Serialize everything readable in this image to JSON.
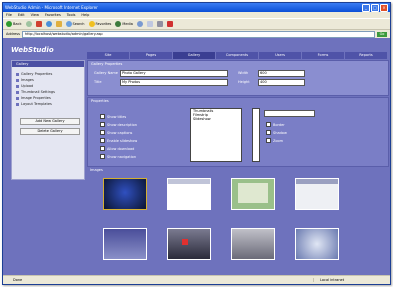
{
  "window": {
    "title": "WebStudio Admin - Microsoft Internet Explorer"
  },
  "menu": [
    "File",
    "Edit",
    "View",
    "Favorites",
    "Tools",
    "Help"
  ],
  "toolbar": {
    "back": "Back",
    "search": "Search",
    "favorites": "Favorites",
    "media": "Media"
  },
  "address": {
    "label": "Address",
    "value": "http://localhost/webstudio/admin/gallery.asp",
    "go": "Go"
  },
  "app": {
    "logo": "WebStudio"
  },
  "sidebar": {
    "header": "Gallery",
    "items": [
      "Gallery Properties",
      "Images",
      "Upload",
      "Thumbnail Settings",
      "Image Properties",
      "Layout Templates"
    ],
    "buttons": [
      "Add New Gallery",
      "Delete Gallery"
    ]
  },
  "tabs": [
    "Site",
    "Pages",
    "Gallery",
    "Components",
    "Users",
    "Forms",
    "Reports"
  ],
  "form": {
    "header": "Gallery Properties",
    "name_label": "Gallery Name",
    "name_value": "Photo Gallery",
    "width_label": "Width",
    "width_value": "600",
    "title_label": "Title",
    "title_value": "My Photos",
    "height_label": "Height",
    "height_value": "400"
  },
  "properties": {
    "header": "Properties",
    "checks": [
      "Show titles",
      "Show description",
      "Show captions",
      "Enable slideshow",
      "Allow download",
      "Show navigation"
    ],
    "options": [
      "Thumbnails",
      "Filmstrip",
      "Slideshow"
    ],
    "right_checks": [
      "Border",
      "Shadow",
      "Zoom"
    ]
  },
  "gallery": {
    "header": "Images"
  },
  "status": {
    "text": "Done",
    "zone": "Local intranet"
  },
  "colors": {
    "content_bg": "#6e72bd",
    "tab_bg": "#4f53a8",
    "panel_bg": "#8a8ed0"
  }
}
